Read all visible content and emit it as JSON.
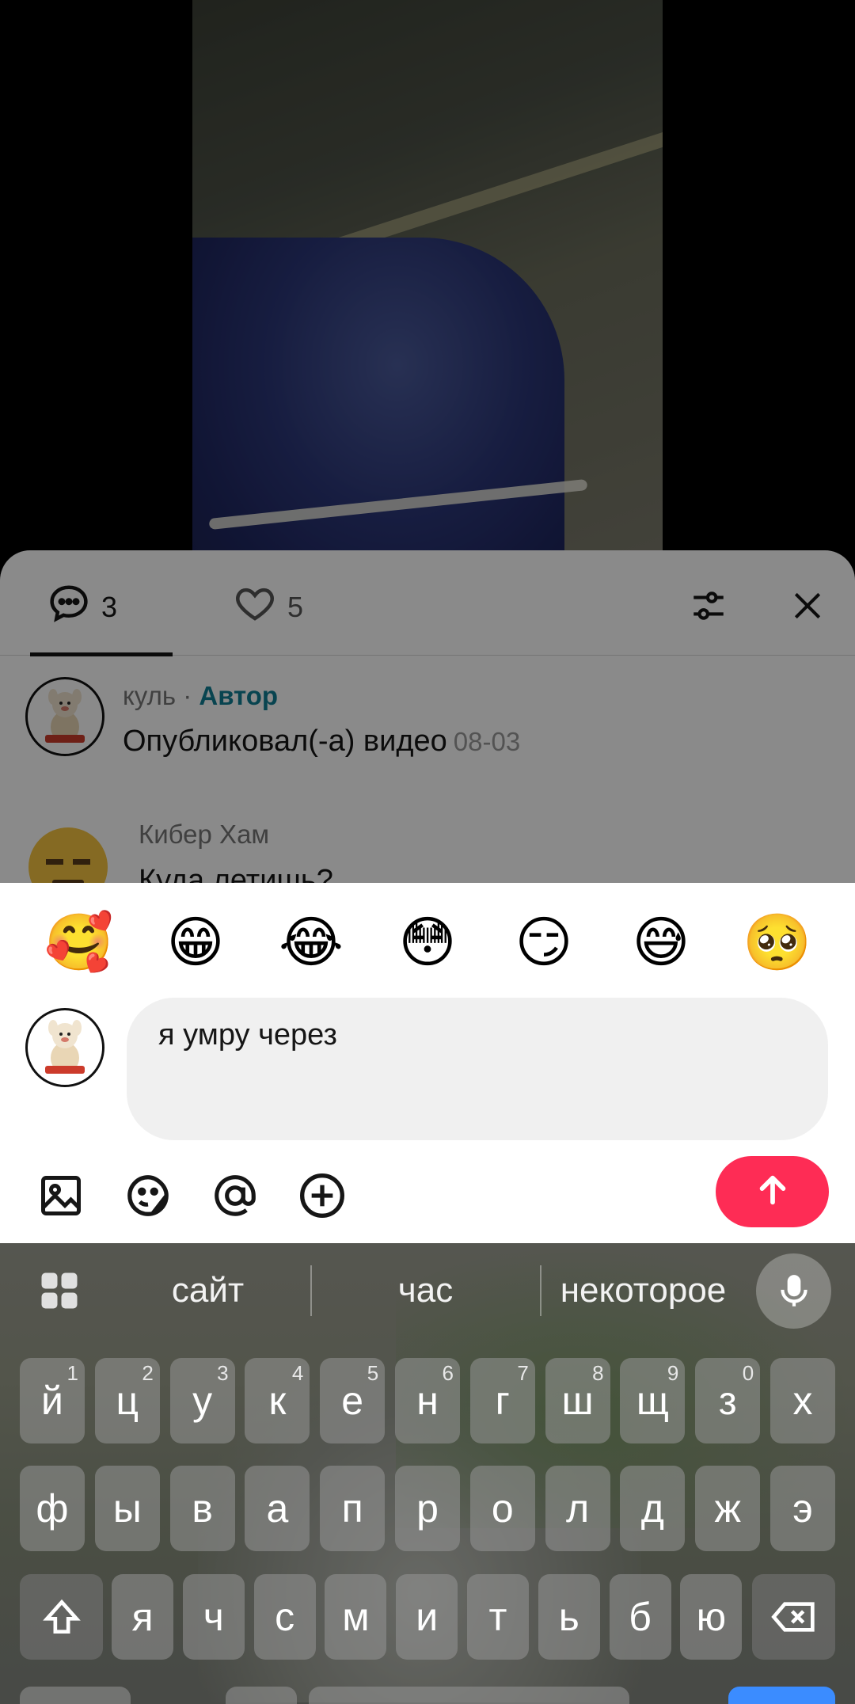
{
  "comments_panel": {
    "tabs": [
      {
        "label": "3"
      },
      {
        "label": "5"
      }
    ],
    "comments": [
      {
        "user": "куль",
        "separator": " · ",
        "badge": "Автор",
        "text": "Опубликовал(-а) видео",
        "date": "08-03"
      },
      {
        "user": "Кибер Хам",
        "text": "Куда летишь?"
      }
    ]
  },
  "composer": {
    "emojis": [
      "🥰",
      "😁",
      "😂",
      "😳",
      "😏",
      "😅",
      "🥺"
    ],
    "input_value": "я умру через",
    "tools": [
      "image-icon",
      "sticker-icon",
      "mention-icon",
      "add-icon"
    ],
    "send_icon": "arrow-up-icon"
  },
  "keyboard": {
    "suggestions": [
      "сайт",
      "час",
      "некоторое"
    ],
    "row1": [
      {
        "k": "й",
        "h": "1"
      },
      {
        "k": "ц",
        "h": "2"
      },
      {
        "k": "у",
        "h": "3"
      },
      {
        "k": "к",
        "h": "4"
      },
      {
        "k": "е",
        "h": "5"
      },
      {
        "k": "н",
        "h": "6"
      },
      {
        "k": "г",
        "h": "7"
      },
      {
        "k": "ш",
        "h": "8"
      },
      {
        "k": "щ",
        "h": "9"
      },
      {
        "k": "з",
        "h": "0"
      },
      {
        "k": "х",
        "h": ""
      }
    ],
    "row2": [
      "ф",
      "ы",
      "в",
      "а",
      "п",
      "р",
      "о",
      "л",
      "д",
      "ж",
      "э"
    ],
    "row3": [
      "я",
      "ч",
      "с",
      "м",
      "и",
      "т",
      "ь",
      "б",
      "ю"
    ]
  },
  "colors": {
    "accent": "#fe2c55",
    "author_badge": "#0f7f94"
  }
}
